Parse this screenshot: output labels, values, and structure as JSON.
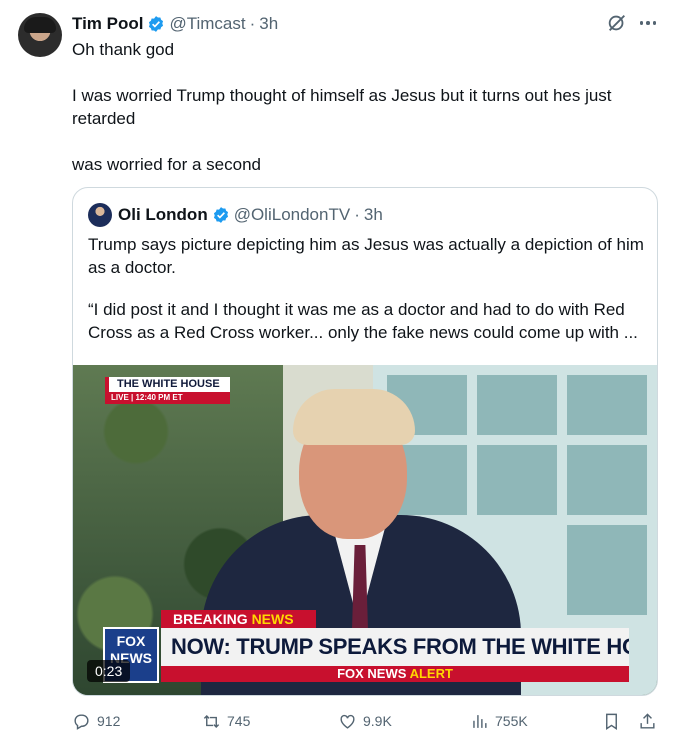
{
  "tweet": {
    "author_name": "Tim Pool",
    "handle": "@Timcast",
    "separator": "·",
    "time": "3h",
    "text_lines": [
      "Oh thank god",
      "I was worried Trump thought of himself as Jesus but it turns out hes just retarded",
      "was worried for a second"
    ]
  },
  "quote": {
    "author_name": "Oli London",
    "handle": "@OliLondonTV",
    "separator": "·",
    "time": "3h",
    "text_lines": [
      "Trump says picture depicting him as Jesus was actually a depiction of him as a doctor.",
      "“I did post it and I thought it was me as a doctor and had to do with Red Cross as a Red Cross worker... only the fake news could come up with ..."
    ],
    "video": {
      "tag_top": "THE WHITE HOUSE",
      "tag_bottom": "LIVE | 12:40 PM ET",
      "breaking_white": "BREAKING",
      "breaking_yellow": "NEWS",
      "headline": "NOW: TRUMP SPEAKS FROM THE WHITE HOUSE",
      "alert_white": "FOX NEWS",
      "alert_yellow": "ALERT",
      "logo_text": "FOX NEWS",
      "duration": "0:23"
    }
  },
  "actions": {
    "replies": "912",
    "reposts": "745",
    "likes": "9.9K",
    "views": "755K"
  },
  "colors": {
    "verified": "#1d9bf0",
    "secondary_text": "#536471",
    "fox_red": "#c8102e",
    "fox_yellow": "#ffd800"
  },
  "icons": [
    "verified-badge-icon",
    "grok-icon",
    "more-icon",
    "reply-icon",
    "repost-icon",
    "like-icon",
    "views-icon",
    "bookmark-icon",
    "share-icon"
  ]
}
